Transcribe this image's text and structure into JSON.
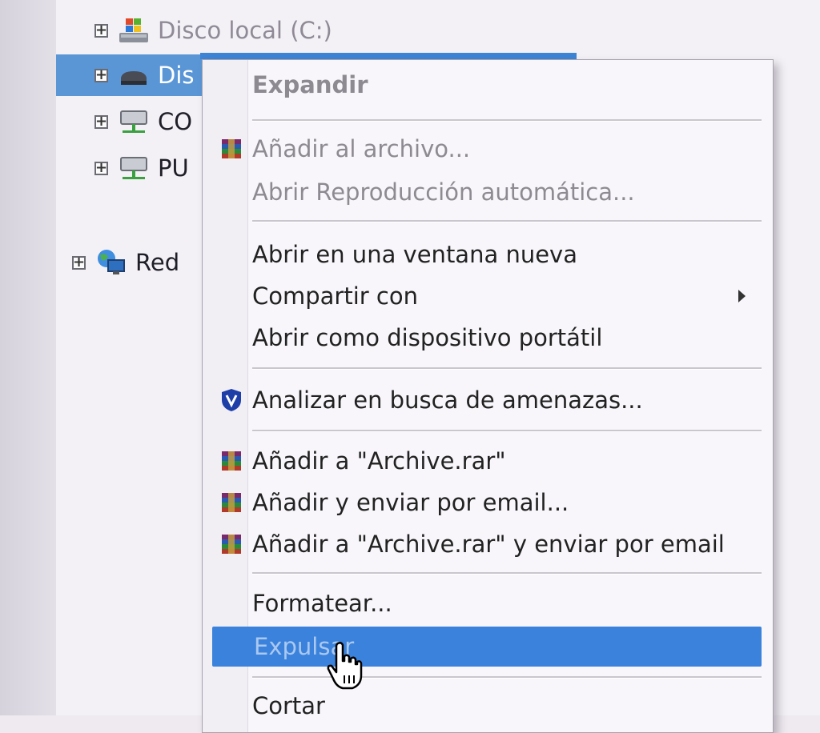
{
  "tree": {
    "items": [
      {
        "label": "Disco local (C:)",
        "icon": "windows-drive-icon",
        "state": "dim"
      },
      {
        "label": "Dis",
        "icon": "removable-drive-icon",
        "state": "selected"
      },
      {
        "label": "CO",
        "icon": "network-drive-icon",
        "state": "normal"
      },
      {
        "label": "PU",
        "icon": "network-drive-icon",
        "state": "normal"
      },
      {
        "label": "Red",
        "icon": "network-globe-icon",
        "state": "normal"
      }
    ],
    "expander_glyph": "+"
  },
  "context_menu": {
    "items": [
      {
        "label": "Expandir",
        "style": "bold-disabled"
      },
      {
        "label": "Añadir al archivo...",
        "icon": "winrar-icon",
        "style": "disabled"
      },
      {
        "label": "Abrir Reproducción automática...",
        "style": "disabled"
      },
      {
        "label": "Abrir en una ventana nueva"
      },
      {
        "label": "Compartir con",
        "submenu": true
      },
      {
        "label": "Abrir como dispositivo portátil"
      },
      {
        "label": "Analizar en busca de amenazas...",
        "icon": "antivirus-shield-icon"
      },
      {
        "label": "Añadir a \"Archive.rar\"",
        "icon": "winrar-icon"
      },
      {
        "label": "Añadir y enviar por email...",
        "icon": "winrar-icon"
      },
      {
        "label": "Añadir a \"Archive.rar\" y enviar por email",
        "icon": "winrar-icon"
      },
      {
        "label": "Formatear..."
      },
      {
        "label": "Expulsar",
        "state": "highlighted"
      },
      {
        "label": "Cortar"
      }
    ]
  },
  "cursor": {
    "icon": "hand-pointer-icon"
  },
  "colors": {
    "selection": "#5a96d6",
    "highlight": "#3a82dc",
    "menu_bg": "#f8f6fa",
    "text": "#222222",
    "disabled_text": "#8e8a92"
  }
}
